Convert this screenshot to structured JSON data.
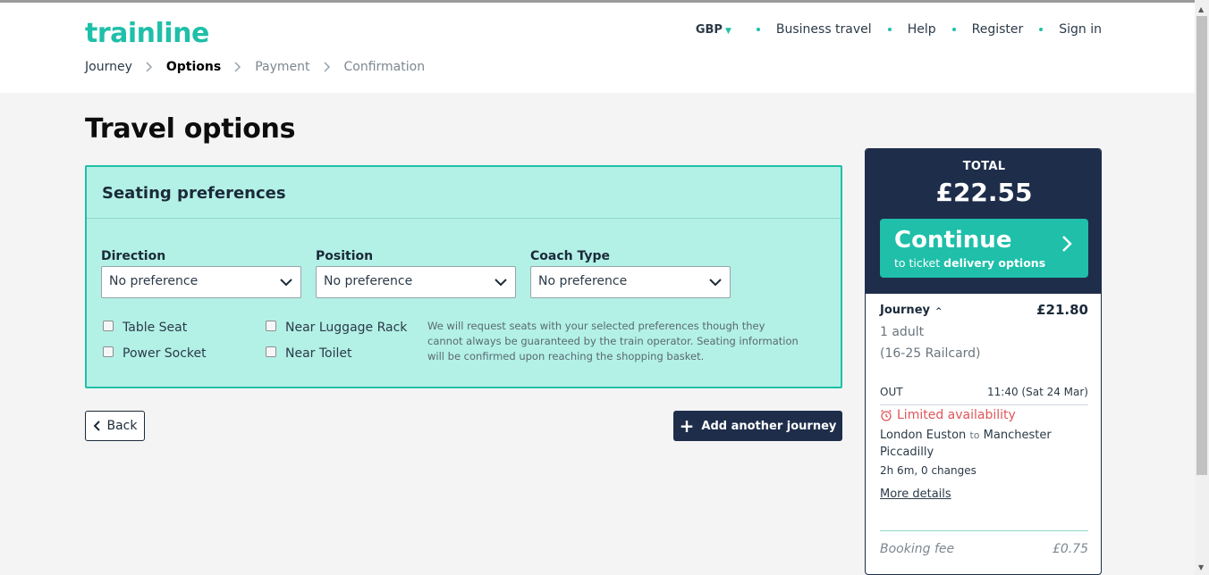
{
  "brand": {
    "logo_text": "trainline",
    "accent_color": "#1fbfa9",
    "navy_color": "#1e2d4a"
  },
  "breadcrumb": [
    {
      "label": "Journey",
      "state": "done"
    },
    {
      "label": "Options",
      "state": "active"
    },
    {
      "label": "Payment",
      "state": "upcoming"
    },
    {
      "label": "Confirmation",
      "state": "upcoming"
    }
  ],
  "topnav": {
    "currency": "GBP",
    "currency_icon": "chevron-down-icon",
    "items": [
      "Business travel",
      "Help",
      "Register",
      "Sign in"
    ]
  },
  "page_title": "Travel options",
  "seating": {
    "title": "Seating preferences",
    "selects": [
      {
        "label": "Direction",
        "value": "No preference"
      },
      {
        "label": "Position",
        "value": "No preference"
      },
      {
        "label": "Coach Type",
        "value": "No preference"
      }
    ],
    "checkboxes": [
      {
        "label": "Table Seat",
        "checked": false
      },
      {
        "label": "Power Socket",
        "checked": false
      },
      {
        "label": "Near Luggage Rack",
        "checked": false
      },
      {
        "label": "Near Toilet",
        "checked": false
      }
    ],
    "note": "We will request seats with your selected preferences though they cannot always be guaranteed by the train operator. Seating information will be confirmed upon reaching the shopping basket."
  },
  "actions": {
    "back_label": "Back",
    "add_journey_label": "Add another journey"
  },
  "summary": {
    "total_label": "TOTAL",
    "total_value": "£22.55",
    "continue_label": "Continue",
    "continue_sub_prefix": "to ticket",
    "continue_sub_bold": "delivery options",
    "journey_label": "Journey",
    "journey_price": "£21.80",
    "passengers": "1 adult",
    "railcard": "(16-25 Railcard)",
    "out_label": "OUT",
    "out_time": "11:40 (Sat 24 Mar)",
    "availability": "Limited availability",
    "origin": "London Euston",
    "to_word": "to",
    "destination": "Manchester Piccadilly",
    "duration": "2h 6m, 0 changes",
    "more_details": "More details",
    "fee_label": "Booking fee",
    "fee_value": "£0.75"
  }
}
